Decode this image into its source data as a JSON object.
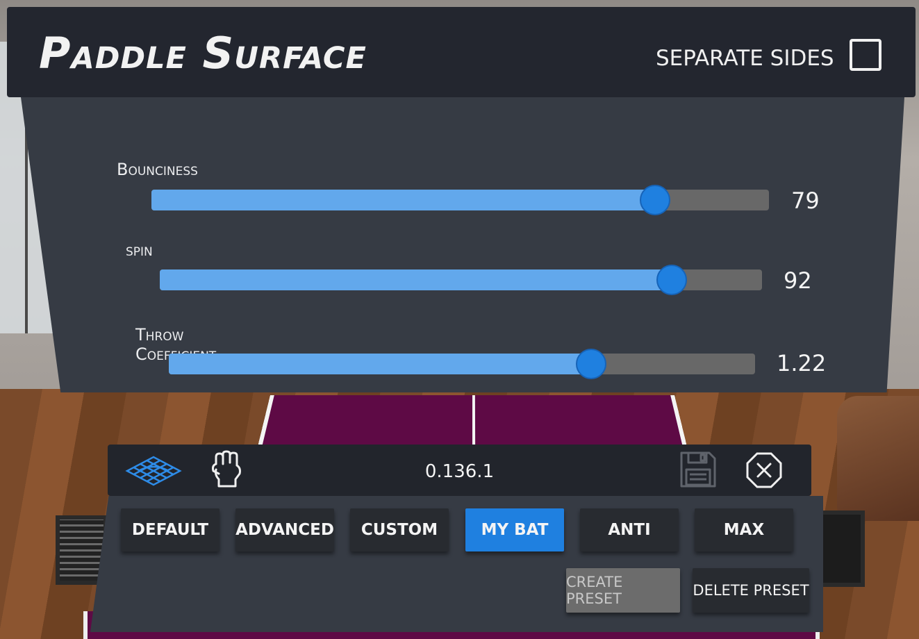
{
  "panel": {
    "title": "Paddle Surface",
    "separate_sides_label": "SEPARATE SIDES",
    "separate_sides_checked": false
  },
  "parameters": [
    {
      "label": "Bounciness",
      "value": "79",
      "fill_fraction": 0.815
    },
    {
      "label": "spin",
      "value": "92",
      "fill_fraction": 0.85
    },
    {
      "label": "Throw Coefficient",
      "value": "1.22",
      "fill_fraction": 0.72
    }
  ],
  "toolbar": {
    "version": "0.136.1",
    "icons": [
      "surface-mesh-icon",
      "fist-icon",
      "save-icon",
      "close-icon"
    ]
  },
  "presets": {
    "items": [
      "DEFAULT",
      "ADVANCED",
      "CUSTOM",
      "MY BAT",
      "ANTI",
      "MAX"
    ],
    "selected": "MY BAT",
    "create_label": "CREATE PRESET",
    "delete_label": "DELETE PRESET"
  },
  "colors": {
    "accent": "#1f80e0",
    "slider_fill": "#62a8ec",
    "panel_dark": "#23262f",
    "panel": "#363b44"
  }
}
